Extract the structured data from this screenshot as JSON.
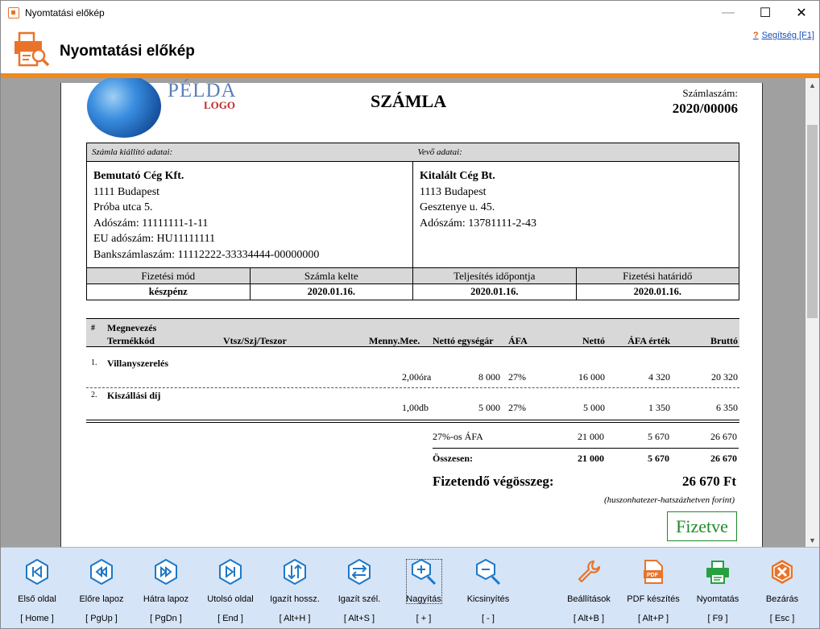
{
  "window": {
    "title": "Nyomtatási előkép"
  },
  "header": {
    "title": "Nyomtatási előkép",
    "help_label": "Segítség [F1]"
  },
  "invoice": {
    "logo_text": "PÉLDA",
    "logo_sub": "LOGO",
    "title": "SZÁMLA",
    "number_label": "Számlaszám:",
    "number": "2020/00006",
    "issuer_header": "Számla kiállító adatai:",
    "buyer_header": "Vevő adatai:",
    "issuer": {
      "name": "Bemutató Cég Kft.",
      "lines": [
        "1111 Budapest",
        "Próba utca 5.",
        "Adószám: 11111111-1-11",
        "EU adószám: HU11111111",
        "Bankszámlaszám: 11112222-33334444-00000000"
      ]
    },
    "buyer": {
      "name": "Kitalált Cég Bt.",
      "lines": [
        "1113 Budapest",
        "Gesztenye u. 45.",
        "Adószám: 13781111-2-43"
      ]
    },
    "payment": [
      {
        "label": "Fizetési mód",
        "value": "készpénz"
      },
      {
        "label": "Számla kelte",
        "value": "2020.01.16."
      },
      {
        "label": "Teljesítés időpontja",
        "value": "2020.01.16."
      },
      {
        "label": "Fizetési határidő",
        "value": "2020.01.16."
      }
    ],
    "columns": {
      "num": "#",
      "name": "Megnevezés",
      "code": "Termékkód",
      "vtsz": "Vtsz/Szj/Teszor",
      "qty": "Menny.Mee.",
      "unit_price": "Nettó egységár",
      "vat": "ÁFA",
      "net": "Nettó",
      "vat_value": "ÁFA érték",
      "gross": "Bruttó"
    },
    "items": [
      {
        "num": "1.",
        "name": "Villanyszerelés",
        "qty": "2,00",
        "unit": "óra",
        "unit_price": "8 000",
        "vat": "27%",
        "net": "16 000",
        "vat_value": "4 320",
        "gross": "20 320"
      },
      {
        "num": "2.",
        "name": "Kiszállási díj",
        "qty": "1,00",
        "unit": "db",
        "unit_price": "5 000",
        "vat": "27%",
        "net": "5 000",
        "vat_value": "1 350",
        "gross": "6 350"
      }
    ],
    "vat_summary": {
      "label": "27%-os ÁFA",
      "net": "21 000",
      "vat": "5 670",
      "gross": "26 670"
    },
    "total": {
      "label": "Összesen:",
      "net": "21 000",
      "vat": "5 670",
      "gross": "26 670"
    },
    "final_label": "Fizetendő végösszeg:",
    "final_value": "26 670 Ft",
    "final_words": "(huszonhatezer-hatszázhetven forint)",
    "paid_stamp": "Fizetve"
  },
  "toolbar": [
    {
      "name": "first-page",
      "label": "Első oldal",
      "key": "[ Home ]",
      "icon": "first-page-icon"
    },
    {
      "name": "prev-page",
      "label": "Előre lapoz",
      "key": "[ PgUp ]",
      "icon": "prev-page-icon"
    },
    {
      "name": "next-page",
      "label": "Hátra lapoz",
      "key": "[ PgDn ]",
      "icon": "next-page-icon"
    },
    {
      "name": "last-page",
      "label": "Utolsó oldal",
      "key": "[ End ]",
      "icon": "last-page-icon"
    },
    {
      "name": "fit-height",
      "label": "Igazít hossz.",
      "key": "[ Alt+H ]",
      "icon": "fit-height-icon"
    },
    {
      "name": "fit-width",
      "label": "Igazít szél.",
      "key": "[ Alt+S ]",
      "icon": "fit-width-icon"
    },
    {
      "name": "zoom-in",
      "label": "Nagyítás",
      "key": "[ + ]",
      "icon": "zoom-in-icon"
    },
    {
      "name": "zoom-out",
      "label": "Kicsinyítés",
      "key": "[ - ]",
      "icon": "zoom-out-icon"
    },
    {
      "name": "settings",
      "label": "Beállítások",
      "key": "[ Alt+B ]",
      "icon": "wrench-icon"
    },
    {
      "name": "pdf-export",
      "label": "PDF készítés",
      "key": "[ Alt+P ]",
      "icon": "pdf-icon"
    },
    {
      "name": "print",
      "label": "Nyomtatás",
      "key": "[ F9 ]",
      "icon": "printer-icon"
    },
    {
      "name": "close",
      "label": "Bezárás",
      "key": "[ Esc ]",
      "icon": "close-icon"
    }
  ],
  "colors": {
    "accent": "#f08a1c",
    "toolbar_bg": "#d6e4f7",
    "nav_blue": "#1e78c8",
    "paid_green": "#1e8a2a",
    "close_orange": "#e8742a"
  }
}
